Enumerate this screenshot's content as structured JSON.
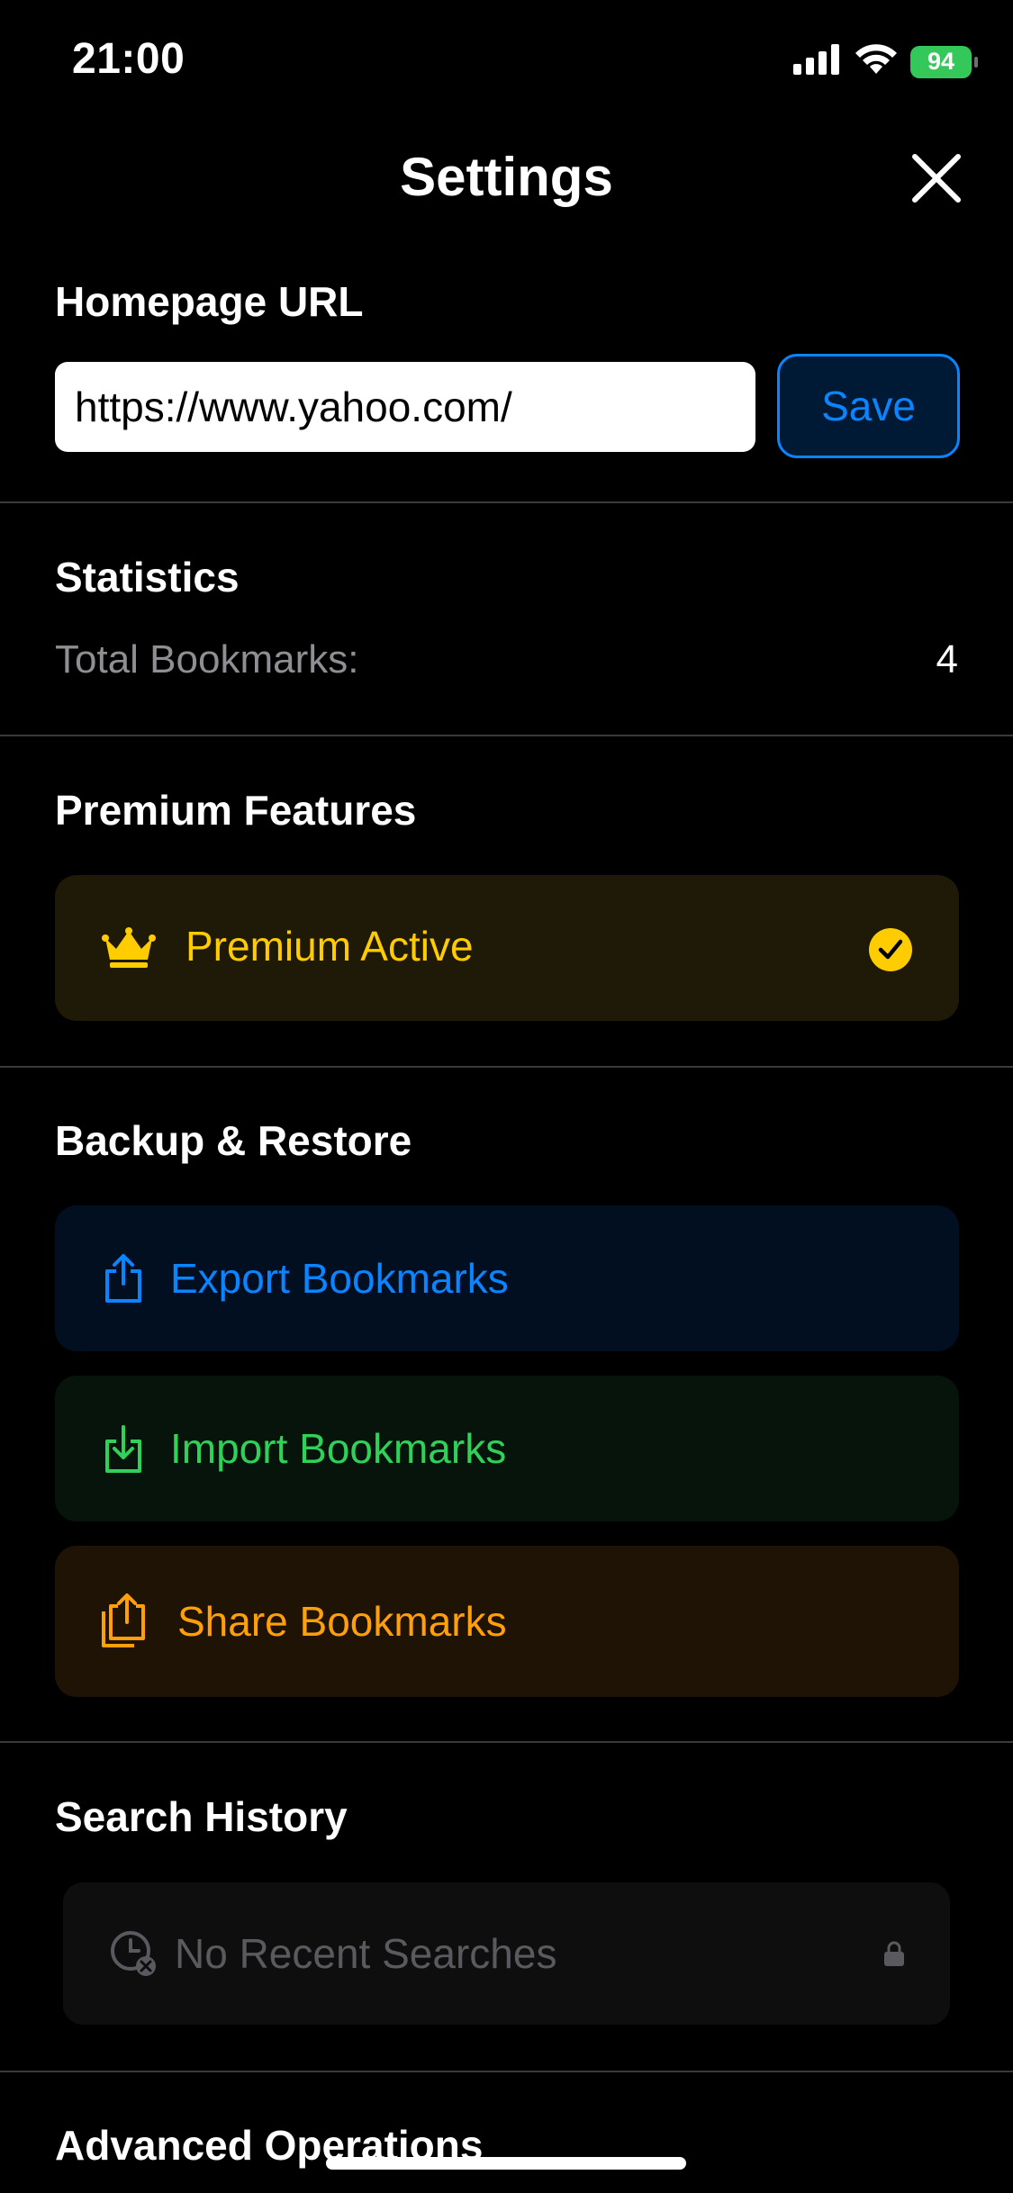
{
  "status_bar": {
    "time": "21:00",
    "battery": "94"
  },
  "header": {
    "title": "Settings"
  },
  "homepage": {
    "title": "Homepage URL",
    "url_value": "https://www.yahoo.com/",
    "save_label": "Save"
  },
  "statistics": {
    "title": "Statistics",
    "total_label": "Total Bookmarks:",
    "total_value": "4"
  },
  "premium": {
    "title": "Premium Features",
    "status_label": "Premium Active"
  },
  "backup": {
    "title": "Backup & Restore",
    "export_label": "Export Bookmarks",
    "import_label": "Import Bookmarks",
    "share_label": "Share Bookmarks"
  },
  "search_history": {
    "title": "Search History",
    "empty_label": "No Recent Searches"
  },
  "advanced": {
    "title": "Advanced Operations"
  },
  "icons": {
    "close": "close-icon",
    "crown": "crown-icon",
    "check": "checkmark-circle-icon",
    "export": "share-upload-icon",
    "import": "download-tray-icon",
    "share": "stacked-share-icon",
    "history": "clock-x-icon",
    "lock": "lock-icon"
  },
  "colors": {
    "accent_blue": "#0a84ff",
    "accent_green": "#30d158",
    "accent_orange": "#ff9f0a",
    "accent_yellow": "#ffcc00",
    "battery_green": "#34c759"
  }
}
